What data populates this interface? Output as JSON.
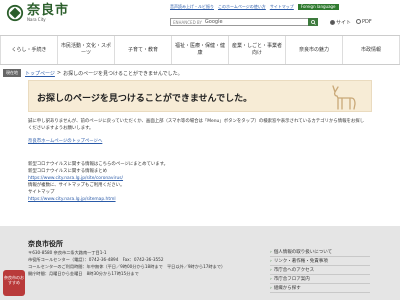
{
  "header": {
    "logo_title": "奈良市",
    "logo_sub": "Nara City",
    "top_links": [
      "音声読み上げ・ルビ振り",
      "このホームページの使い方",
      "サイトマップ",
      "Foreign language"
    ],
    "search_label": "ENHANCED BY",
    "search_brand": "Google",
    "radio_site": "サイト",
    "radio_pdf": "PDF"
  },
  "nav": {
    "items": [
      "くらし・手続き",
      "市民活動・文化・スポーツ",
      "子育て・教育",
      "福祉・医療・保健・健康",
      "産業・しごと・事業者向け",
      "奈良市の魅力",
      "市政情報"
    ]
  },
  "breadcrumb": {
    "badge": "現在地",
    "home": "トップページ",
    "sep": ">",
    "current": "お探しのページを見つけることができませんでした。"
  },
  "error": {
    "title": "お探しのページを見つけることができませんでした。"
  },
  "body": {
    "para1": "誠に申し訳ありませんが、前のページに戻っていただくか、画面上部（スマホ等の場合は「Menu」ボタンをタップ）の検索窓や表示されているカテゴリから情報をお探しくださいますようお願いします。",
    "home_link": "奈良市ホームページのトップページへ",
    "covid_1": "新型コロナウイルスに関する情報はこちらのページにまとめています。",
    "covid_2": "新型コロナウイルスに関する情報まとめ",
    "covid_url": "https://www.city.nara.lg.jp/site/coronavirus/",
    "sitemap_1": "情報が複数に、サイトマップもご利用ください。",
    "sitemap_2": "サイトマップ",
    "sitemap_url": "https://www.city.nara.lg.jp/sitemap.html"
  },
  "footer": {
    "title": "奈良市役所",
    "address": "〒630-8580 奈良市二条大路南一丁目1-1",
    "phone": "市役所コールセンター（電話）：0742-36-4894　Fax：0742-36-3552",
    "hours": "コールセンターのご利用時間：年中無休（平日／9時00分から18時まで　平日以外／9時から17時まで）",
    "office_hours": "開庁時間：月曜日から金曜日　8時30分から17時15分まで",
    "links": [
      "個人情報の取り扱いについて",
      "リンク・著作権・免責事項",
      "市庁舎へのアクセス",
      "市庁舎フロア案内",
      "組織から探す"
    ],
    "mascot": "奈良市のおすすめ"
  }
}
